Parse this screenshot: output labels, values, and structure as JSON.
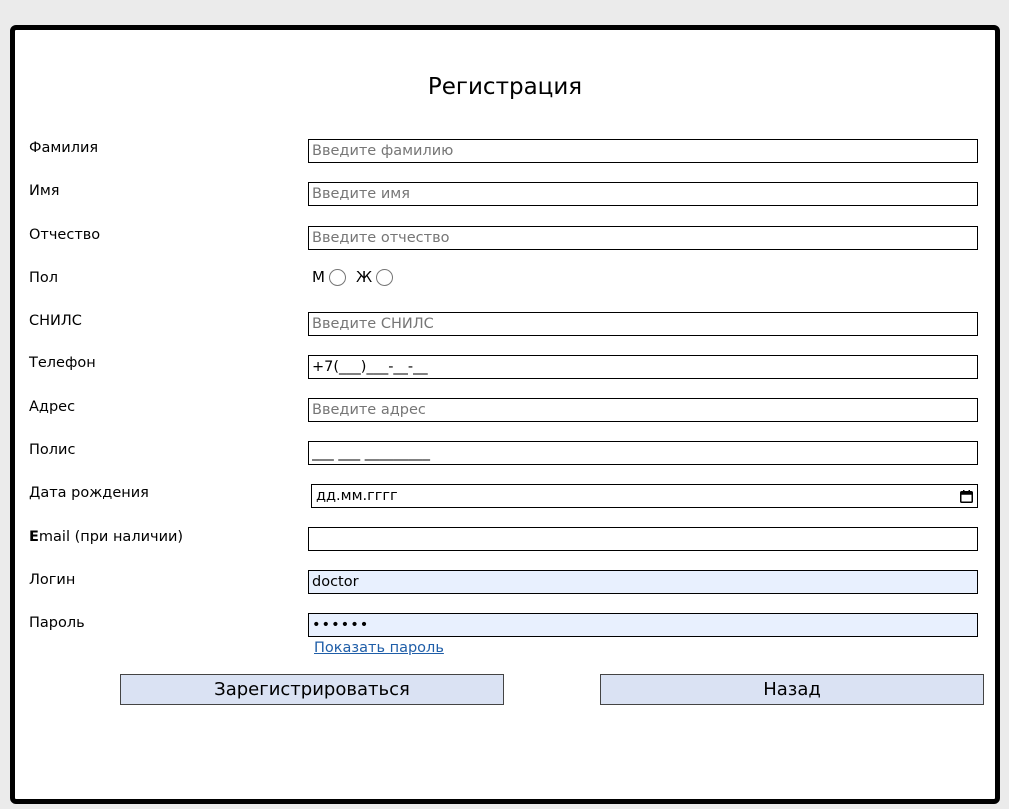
{
  "page": {
    "title": "Регистрация"
  },
  "fields": {
    "surname": {
      "label": "Фамилия",
      "placeholder": "Введите фамилию",
      "value": ""
    },
    "name": {
      "label": "Имя",
      "placeholder": "Введите имя",
      "value": ""
    },
    "patronymic": {
      "label": "Отчество",
      "placeholder": "Введите отчество",
      "value": ""
    },
    "gender": {
      "label": "Пол",
      "options": [
        "М",
        "Ж"
      ]
    },
    "snils": {
      "label": "СНИЛС",
      "placeholder": "Введите СНИЛС",
      "value": ""
    },
    "phone": {
      "label": "Телефон",
      "value": "+7(___)___-__-__"
    },
    "address": {
      "label": "Адрес",
      "placeholder": "Введите адрес",
      "value": ""
    },
    "policy": {
      "label": "Полис",
      "value": "___ ___ _________"
    },
    "birthdate": {
      "label": "Дата рождения",
      "value": "дд.мм.гггг"
    },
    "email": {
      "label_bold": "E",
      "label_rest": "mail (при наличии)",
      "value": ""
    },
    "login": {
      "label": "Логин",
      "value": "doctor"
    },
    "password": {
      "label": "Пароль",
      "value": "••••••"
    }
  },
  "show_password_label": "Показать пароль",
  "buttons": {
    "register": "Зарегистрироваться",
    "back": "Назад"
  },
  "colors": {
    "autofill_bg": "#e8f0fe",
    "button_bg": "#dae2f3",
    "link": "#1f5ea8"
  },
  "icons": {
    "date": "calendar-icon"
  }
}
